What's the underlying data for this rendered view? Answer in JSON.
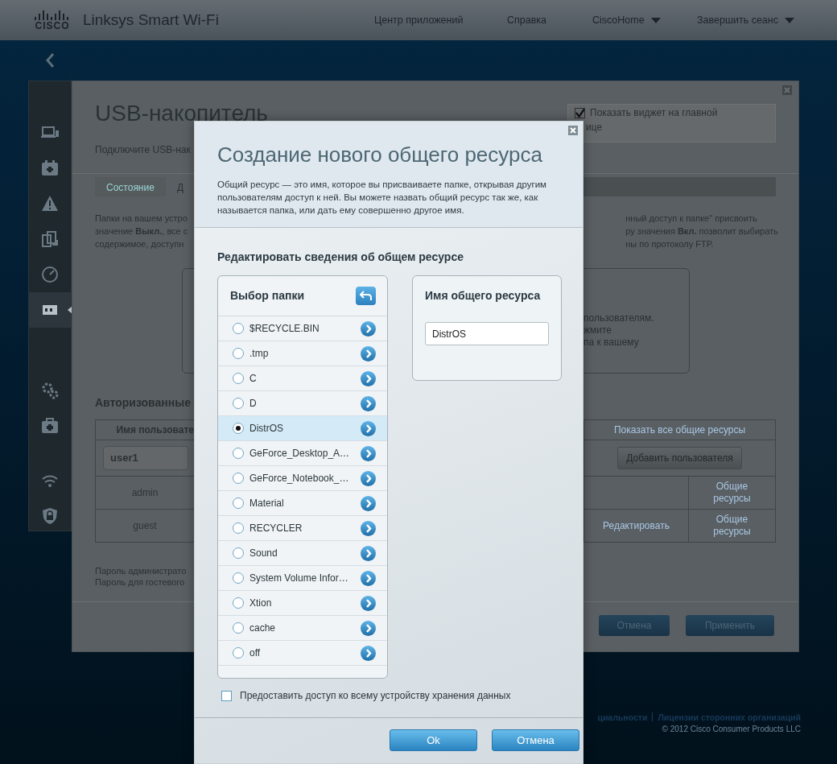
{
  "header": {
    "brand": "CISCO",
    "product": "Linksys Smart Wi-Fi",
    "nav": [
      {
        "label": "Центр приложений",
        "dropdown": false
      },
      {
        "label": "Справка",
        "dropdown": false
      },
      {
        "label": "CiscoHome",
        "dropdown": true
      },
      {
        "label": "Завершить сеанс",
        "dropdown": true
      }
    ]
  },
  "sidebar": {
    "items": [
      {
        "kind": "laptop",
        "selected": false
      },
      {
        "kind": "calendar",
        "selected": false
      },
      {
        "kind": "warning",
        "selected": false
      },
      {
        "kind": "transfer",
        "selected": false
      },
      {
        "kind": "gauge",
        "selected": false
      },
      {
        "kind": "usb",
        "selected": true
      },
      {
        "kind": "gear",
        "selected": false
      },
      {
        "kind": "aid",
        "selected": false
      },
      {
        "kind": "wifi",
        "selected": false
      },
      {
        "kind": "shield",
        "selected": false
      }
    ]
  },
  "background_page": {
    "title": "USB-накопитель",
    "subtitle": "Подключите USB-нак",
    "widget_checkbox": {
      "checked": true,
      "label_lines": [
        "Показать виджет на главной",
        "ице"
      ]
    },
    "tabs": [
      {
        "label": "Состояние",
        "selected": false
      },
      {
        "label": "Д",
        "selected": true
      }
    ],
    "intro_left": [
      "Папки на вашем устро",
      "значение **Выкл.**, все с",
      "содержимое, доступн"
    ],
    "intro_right": [
      "нный доступ к папке\" присвоить",
      "ру значения **Вкл.** позволит выбирать",
      "ны по протоколу FTP."
    ],
    "info_box_lines": [
      "пользователям.",
      "жмите",
      "па к вашему"
    ],
    "users_heading": "Авторизованные",
    "table": {
      "header_left": "Имя пользовате",
      "header_right": "Показать все общие ресурсы",
      "new_user_value": "user1",
      "add_button": "Добавить пользователя",
      "rows": [
        {
          "user": "admin",
          "edit": null,
          "shares": "Общие ресурсы"
        },
        {
          "user": "guest",
          "edit": "Редактировать",
          "shares": "Общие ресурсы"
        }
      ]
    },
    "password_lines": [
      "Пароль администрато",
      "Пароль для гостевого"
    ],
    "buttons": [
      {
        "label": "Отмена"
      },
      {
        "label": "Применить"
      }
    ]
  },
  "footer": {
    "links": [
      "циальности",
      "Лицензии сторонних организаций"
    ],
    "copyright": "© 2012 Cisco Consumer Products LLC"
  },
  "dialog": {
    "title": "Создание нового общего ресурса",
    "description": "Общий ресурс — это имя, которое вы присваиваете папке, открывая другим пользователям доступ к ней. Вы можете назвать общий ресурс так же, как называется папка, или дать ему совершенно другое имя.",
    "section_title": "Редактировать сведения об общем ресурсе",
    "folder_picker": {
      "title": "Выбор папки",
      "folders": [
        {
          "label": "$RECYCLE.BIN",
          "selected": false
        },
        {
          "label": ".tmp",
          "selected": false
        },
        {
          "label": "C",
          "selected": false
        },
        {
          "label": "D",
          "selected": false
        },
        {
          "label": "DistrOS",
          "selected": true
        },
        {
          "label": "GeForce_Desktop_A…",
          "selected": false
        },
        {
          "label": "GeForce_Notebook_…",
          "selected": false
        },
        {
          "label": "Material",
          "selected": false
        },
        {
          "label": "RECYCLER",
          "selected": false
        },
        {
          "label": "Sound",
          "selected": false
        },
        {
          "label": "System Volume Infor…",
          "selected": false
        },
        {
          "label": "Xtion",
          "selected": false
        },
        {
          "label": "cache",
          "selected": false
        },
        {
          "label": "off",
          "selected": false
        }
      ]
    },
    "share_name": {
      "label": "Имя общего ресурса",
      "value": "DistrOS"
    },
    "whole_device_checkbox": {
      "label": "Предоставить доступ ко всему устройству хранения данных",
      "checked": false
    },
    "buttons": [
      {
        "label": "Ok"
      },
      {
        "label": "Отмена"
      }
    ]
  }
}
